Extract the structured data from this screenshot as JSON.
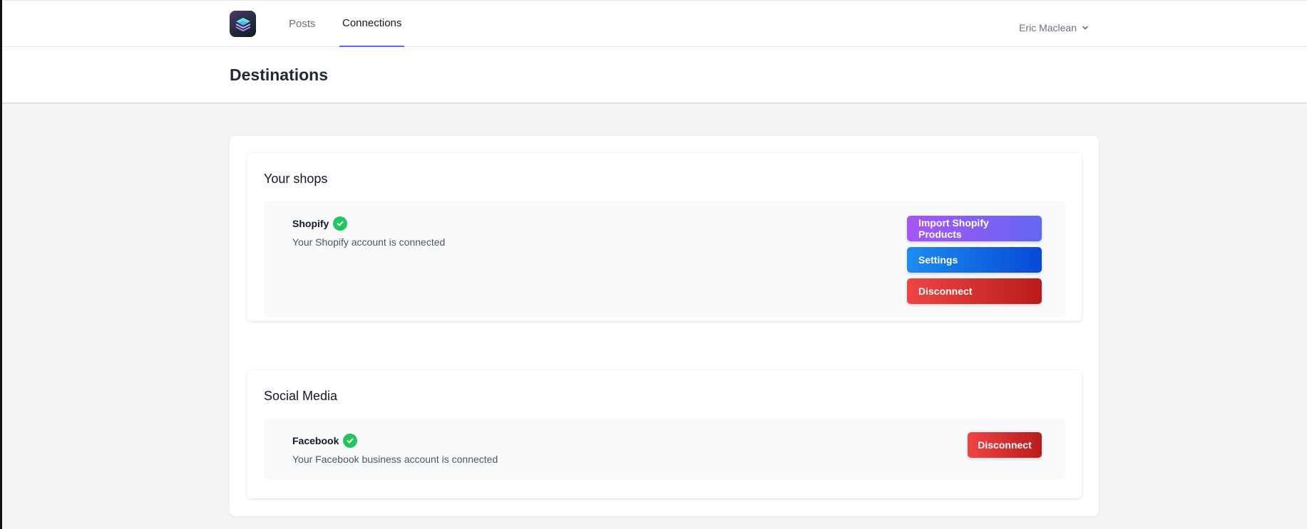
{
  "nav": {
    "tabs": [
      {
        "label": "Posts",
        "active": false
      },
      {
        "label": "Connections",
        "active": true
      }
    ],
    "user_name": "Eric Maclean",
    "logo_icon": "layers-logo-icon",
    "user_menu_icon": "chevron-down-icon"
  },
  "header": {
    "title": "Destinations"
  },
  "sections": {
    "shops": {
      "title": "Your shops",
      "item": {
        "name": "Shopify",
        "status_icon": "check-circle-icon",
        "description": "Your Shopify account is connected",
        "buttons": {
          "import": "Import Shopify Products",
          "settings": "Settings",
          "disconnect": "Disconnect"
        }
      }
    },
    "social": {
      "title": "Social Media",
      "item": {
        "name": "Facebook",
        "status_icon": "check-circle-icon",
        "description": "Your Facebook business account is connected",
        "buttons": {
          "disconnect": "Disconnect"
        }
      }
    }
  },
  "colors": {
    "accent": "#6366f1",
    "success": "#22c55e",
    "danger": "#dc2626",
    "primary": "#0b5ed7",
    "import_start": "#a855f7"
  }
}
